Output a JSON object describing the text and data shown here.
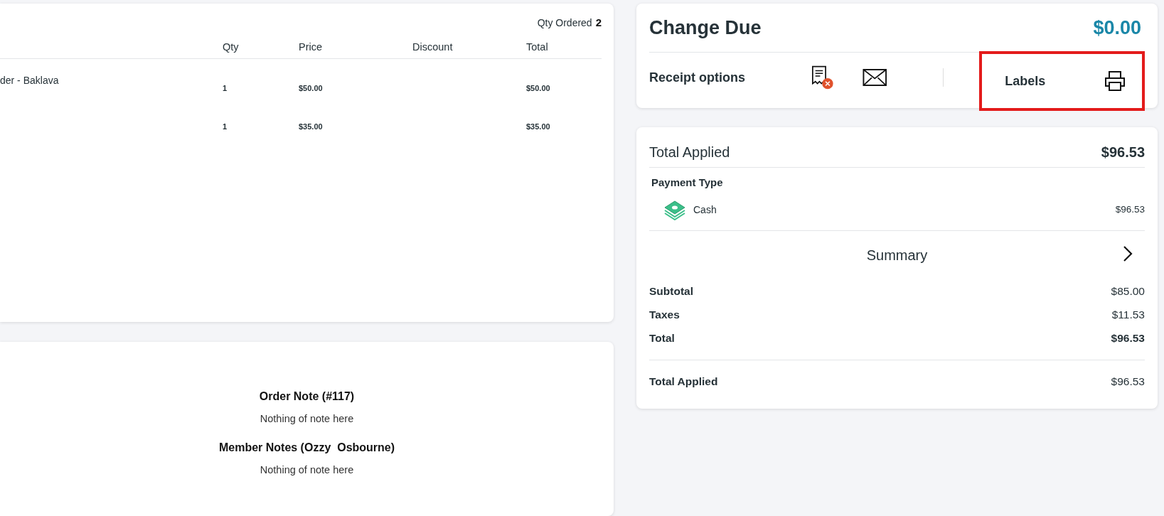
{
  "order": {
    "qty_ordered_label": "Qty Ordered",
    "qty_ordered": "2",
    "columns": [
      "Qty",
      "Price",
      "Discount",
      "Total"
    ],
    "rows": [
      {
        "item": "der - Baklava",
        "qty": "1",
        "price": "$50.00",
        "discount": "",
        "total": "$50.00"
      },
      {
        "item": "",
        "qty": "1",
        "price": "$35.00",
        "discount": "",
        "total": "$35.00"
      }
    ]
  },
  "notes": [
    {
      "title": "Order Note (#117)",
      "text": "Nothing of note here"
    },
    {
      "title": "Member Notes (Ozzy  Osbourne)",
      "text": "Nothing of note here"
    }
  ],
  "change_due": {
    "label": "Change Due",
    "amount": "$0.00",
    "receipt_label": "Receipt options",
    "labels": {
      "label": "Labels",
      "highlighted": true
    }
  },
  "payments": {
    "total_applied_label": "Total Applied",
    "total_applied": "$96.53",
    "type_label": "Payment Type",
    "items": [
      {
        "name": "Cash",
        "amount": "$96.53"
      }
    ]
  },
  "summary": {
    "title": "Summary",
    "rows": [
      {
        "label": "Subtotal",
        "value": "$85.00",
        "emphasis": false
      },
      {
        "label": "Taxes",
        "value": "$11.53",
        "emphasis": false
      },
      {
        "label": "Total",
        "value": "$96.53",
        "emphasis": true
      }
    ],
    "total_applied": {
      "label": "Total Applied",
      "value": "$96.53"
    }
  }
}
